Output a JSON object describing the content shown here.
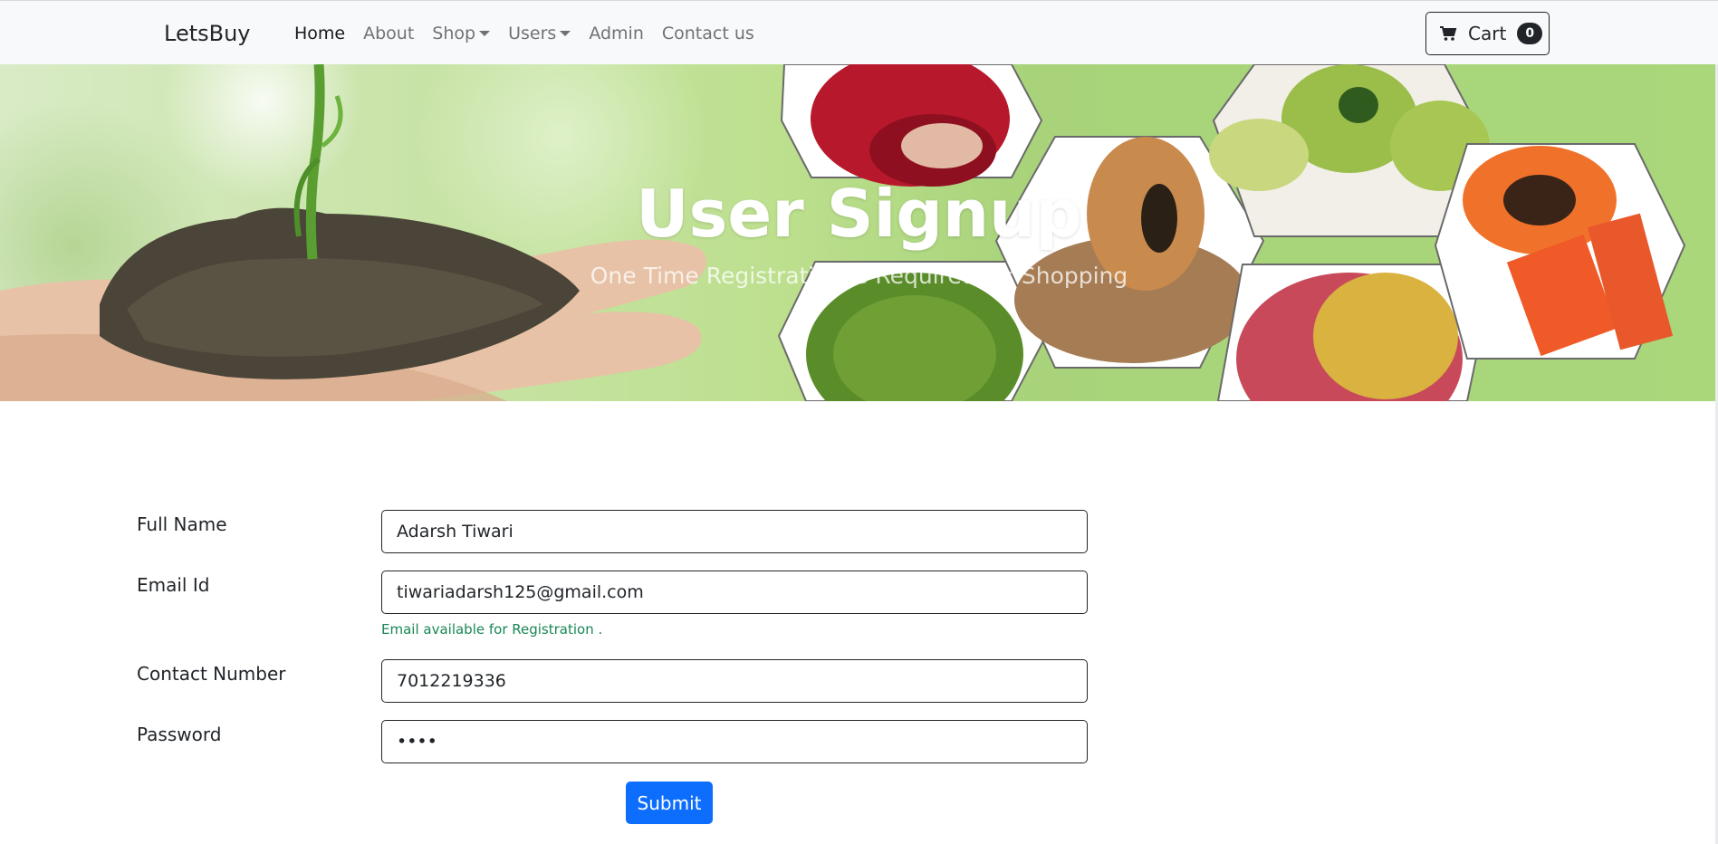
{
  "navbar": {
    "brand": "LetsBuy",
    "links": [
      {
        "label": "Home",
        "active": true,
        "dropdown": false
      },
      {
        "label": "About",
        "active": false,
        "dropdown": false
      },
      {
        "label": "Shop",
        "active": false,
        "dropdown": true
      },
      {
        "label": "Users",
        "active": false,
        "dropdown": true
      },
      {
        "label": "Admin",
        "active": false,
        "dropdown": false
      },
      {
        "label": "Contact us",
        "active": false,
        "dropdown": false
      }
    ],
    "cart": {
      "label": "Cart",
      "count": "0",
      "icon": "cart-icon"
    }
  },
  "hero": {
    "title": "User Signup",
    "subtitle": "One Time Registration is Required for Shopping"
  },
  "form": {
    "full_name": {
      "label": "Full Name",
      "value": "Adarsh Tiwari"
    },
    "email": {
      "label": "Email Id",
      "value": "tiwariadarsh125@gmail.com",
      "help": "Email available for Registration ."
    },
    "contact": {
      "label": "Contact Number",
      "value": "7012219336"
    },
    "password": {
      "label": "Password",
      "value": "••••"
    },
    "submit_label": "Submit"
  },
  "colors": {
    "primary": "#0d6efd",
    "success": "#198754",
    "navbar_bg": "#f8f9fa"
  }
}
